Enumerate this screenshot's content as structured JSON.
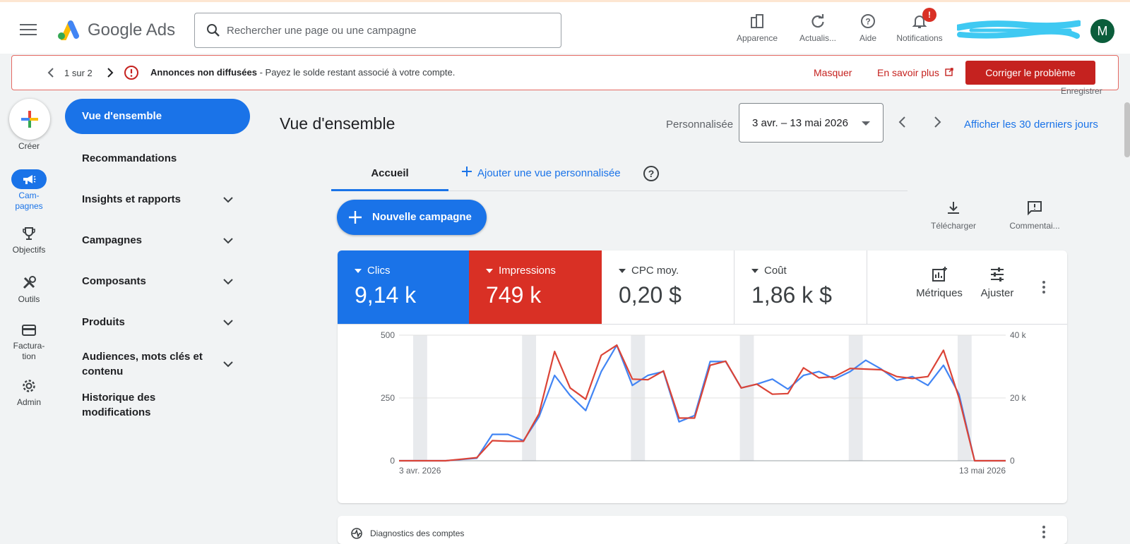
{
  "topbar": {
    "brand": "Google Ads",
    "search_placeholder": "Rechercher une page ou une campagne",
    "buttons": {
      "appearance": "Apparence",
      "refresh": "Actualis...",
      "help": "Aide",
      "notifications": "Notifications"
    },
    "notif_badge": "!",
    "avatar": "M"
  },
  "alert": {
    "pager": "1 sur 2",
    "title": "Annonces non diffusées",
    "message": " - Payez le solde restant associé à votre compte.",
    "dismiss": "Masquer",
    "learn_more": "En savoir plus",
    "fix": "Corriger le problème"
  },
  "save_label": "Enregistrer",
  "rail": {
    "create": "Créer",
    "campaigns": "Cam-\npagnes",
    "goals": "Objectifs",
    "tools": "Outils",
    "billing": "Factura-\ntion",
    "admin": "Admin"
  },
  "nav": {
    "items": [
      {
        "label": "Vue d'ensemble"
      },
      {
        "label": "Recommandations"
      },
      {
        "label": "Insights et rapports"
      },
      {
        "label": "Campagnes"
      },
      {
        "label": "Composants"
      },
      {
        "label": "Produits"
      },
      {
        "label": "Audiences, mots clés et contenu"
      },
      {
        "label": "Historique des modifications"
      }
    ]
  },
  "main": {
    "title": "Vue d'ensemble",
    "range_type": "Personnalisée",
    "date_range": "3 avr. – 13 mai 2026",
    "last30": "Afficher les 30 derniers jours",
    "tabs": {
      "home": "Accueil",
      "add_view": "Ajouter une vue personnalisée"
    },
    "new_campaign": "Nouvelle campagne",
    "download": "Télécharger",
    "feedback": "Commentai...",
    "metrics": [
      {
        "label": "Clics",
        "value": "9,14 k"
      },
      {
        "label": "Impressions",
        "value": "749 k"
      },
      {
        "label": "CPC moy.",
        "value": "0,20 $"
      },
      {
        "label": "Coût",
        "value": "1,86 k $"
      }
    ],
    "tools": {
      "metrics": "Métriques",
      "adjust": "Ajuster"
    },
    "diagnostics": "Diagnostics des comptes"
  },
  "chart_data": {
    "type": "line",
    "x_start_label": "3 avr. 2026",
    "x_end_label": "13 mai 2026",
    "y_left_ticks": [
      "500",
      "250",
      "0"
    ],
    "y_right_ticks": [
      "40 k",
      "20 k",
      "0"
    ],
    "ylim_left": [
      0,
      500
    ],
    "ylim_right": [
      0,
      40000
    ],
    "weekend_days": [
      1,
      8,
      15,
      22,
      29,
      36
    ],
    "series": [
      {
        "name": "Clics",
        "color": "#4285f4",
        "axis": "left",
        "values": [
          0,
          0,
          0,
          0,
          5,
          10,
          105,
          105,
          80,
          175,
          340,
          260,
          200,
          355,
          460,
          300,
          340,
          355,
          155,
          180,
          395,
          395,
          290,
          305,
          325,
          285,
          340,
          355,
          325,
          355,
          400,
          365,
          320,
          335,
          300,
          380,
          265,
          0,
          0,
          0
        ]
      },
      {
        "name": "Impressions",
        "color": "#db4437",
        "axis": "right",
        "values": [
          0,
          0,
          0,
          0,
          500,
          1000,
          6400,
          6200,
          6200,
          15000,
          34800,
          23200,
          19600,
          33600,
          36800,
          26000,
          25800,
          28600,
          13600,
          13600,
          30400,
          31700,
          23200,
          24400,
          21200,
          21400,
          29600,
          26400,
          26800,
          29400,
          29200,
          29000,
          26800,
          26200,
          26800,
          35200,
          20000,
          0,
          0,
          0
        ]
      }
    ]
  },
  "colors": {
    "blue": "#1a73e8",
    "red": "#d93025",
    "alert_red": "#c5221f"
  }
}
